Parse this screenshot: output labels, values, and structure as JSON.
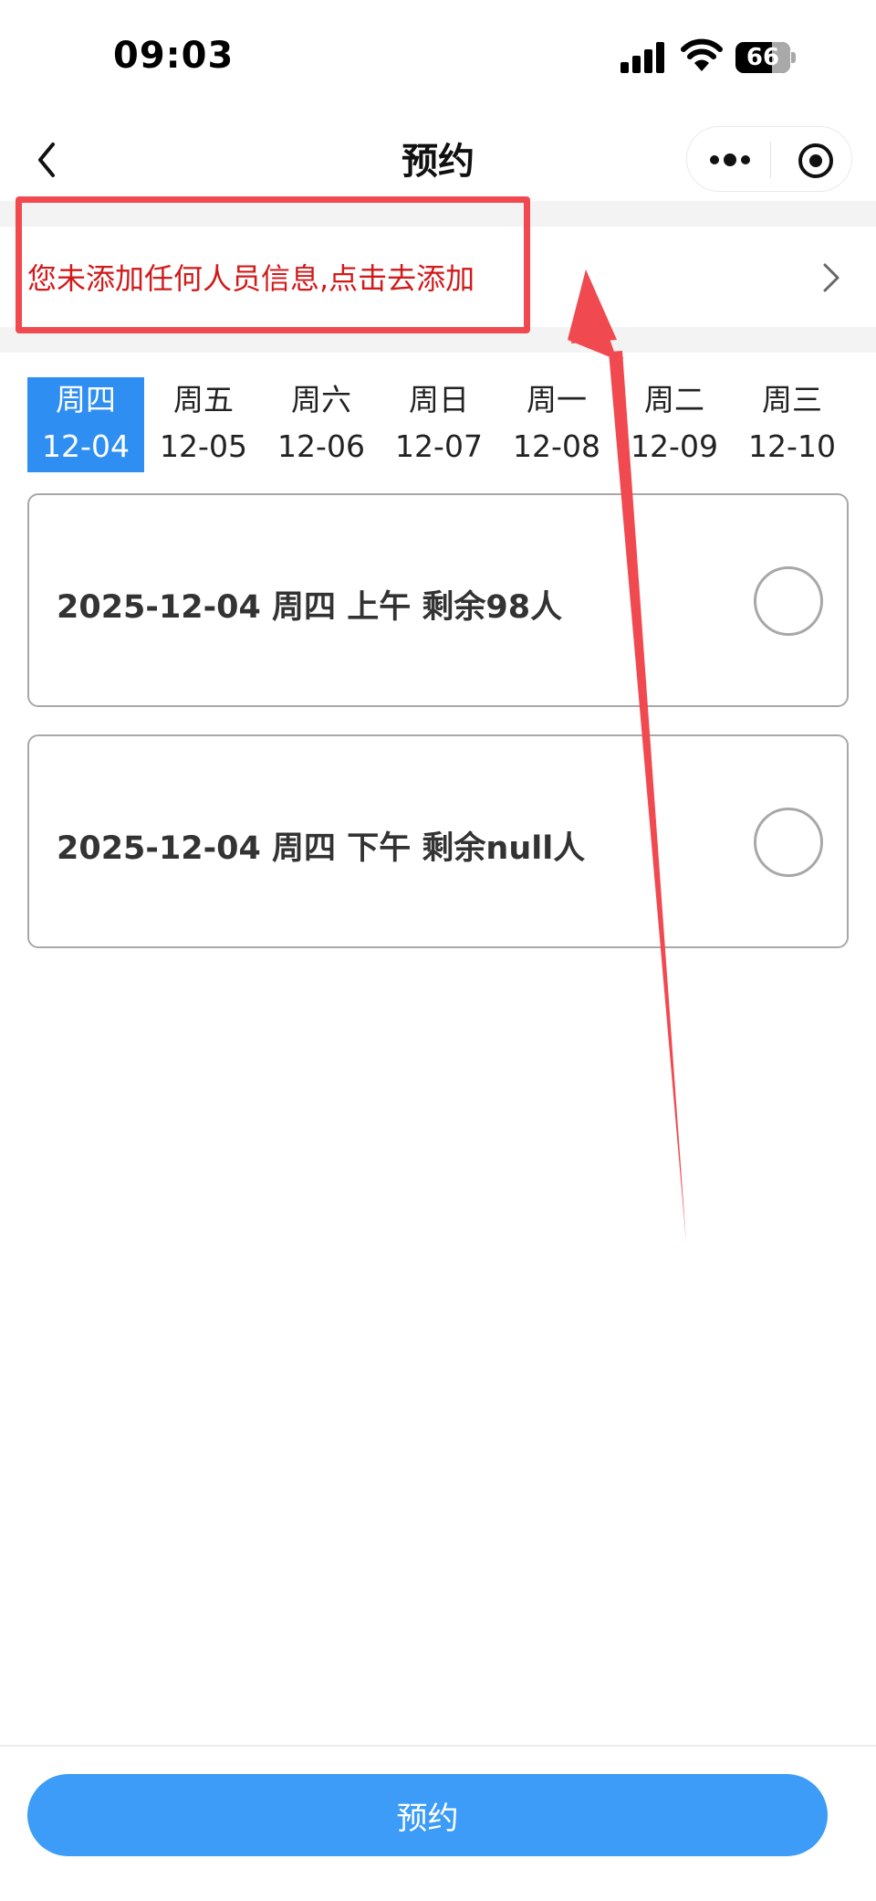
{
  "status_bar": {
    "time": "09:03",
    "battery_percent": 66,
    "battery_label": "66"
  },
  "nav": {
    "title": "预约",
    "icons": [
      "back-icon",
      "more-icon",
      "target-icon"
    ]
  },
  "notice": {
    "text": "您未添加任何人员信息,点击去添加",
    "color": "#d11a1a"
  },
  "date_tabs": [
    {
      "weekday": "周四",
      "date": "12-04",
      "active": true
    },
    {
      "weekday": "周五",
      "date": "12-05",
      "active": false
    },
    {
      "weekday": "周六",
      "date": "12-06",
      "active": false
    },
    {
      "weekday": "周日",
      "date": "12-07",
      "active": false
    },
    {
      "weekday": "周一",
      "date": "12-08",
      "active": false
    },
    {
      "weekday": "周二",
      "date": "12-09",
      "active": false
    },
    {
      "weekday": "周三",
      "date": "12-10",
      "active": false
    }
  ],
  "slots": [
    {
      "label": "2025-12-04 周四 上午 剩余98人",
      "selected": false
    },
    {
      "label": "2025-12-04 周四 下午 剩余null人",
      "selected": false
    }
  ],
  "footer": {
    "submit_label": "预约"
  },
  "colors": {
    "accent": "#2f8ef2",
    "button": "#3c9cf7",
    "annotation": "#f04a50"
  }
}
